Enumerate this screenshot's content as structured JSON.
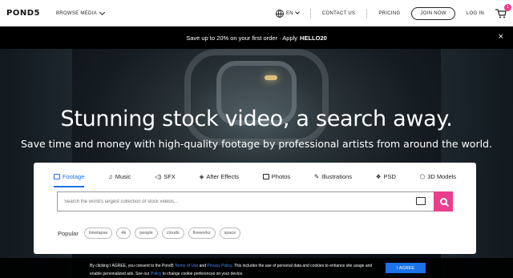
{
  "header": {
    "logo": "POND5",
    "browse_media": "BROWSE MEDIA",
    "language": "EN",
    "contact_us": "CONTACT US",
    "pricing": "PRICING",
    "join_now": "JOIN NOW",
    "log_in": "LOG IN",
    "cart_count": "1"
  },
  "promo": {
    "text": "Save up to 20% on your first order · Apply",
    "code": "HELLO20",
    "close": "×"
  },
  "hero": {
    "title": "Stunning stock video, a search away.",
    "subtitle": "Save time and money with high-quality footage by professional artists from around the world."
  },
  "tabs": [
    {
      "label": "Footage",
      "icon": "footage-icon"
    },
    {
      "label": "Music",
      "icon": "music-icon"
    },
    {
      "label": "SFX",
      "icon": "sfx-icon"
    },
    {
      "label": "After Effects",
      "icon": "after-effects-icon"
    },
    {
      "label": "Photos",
      "icon": "camera-icon"
    },
    {
      "label": "Illustrations",
      "icon": "illustrations-icon"
    },
    {
      "label": "PSD",
      "icon": "psd-icon"
    },
    {
      "label": "3D Models",
      "icon": "cube-icon"
    }
  ],
  "search": {
    "placeholder": "Search the world's largest collection of stock videos..."
  },
  "popular": {
    "label": "Popular",
    "chips": [
      "timelapse",
      "4k",
      "people",
      "clouds",
      "fireworks",
      "space"
    ]
  },
  "cookie": {
    "part1": "By clicking I AGREE, you consent to the Pond5 ",
    "terms": "Terms of Use",
    "and": " and ",
    "privacy": "Privacy Policy",
    "part2": ". This includes the use of personal data and cookies to enhance site usage and enable personalized ads. See our ",
    "policy": "Policy",
    "part3": " to change cookie preferences on your device.",
    "agree": "I AGREE"
  },
  "colors": {
    "accent": "#1a73e8",
    "brand_pink": "#e83e8c"
  }
}
